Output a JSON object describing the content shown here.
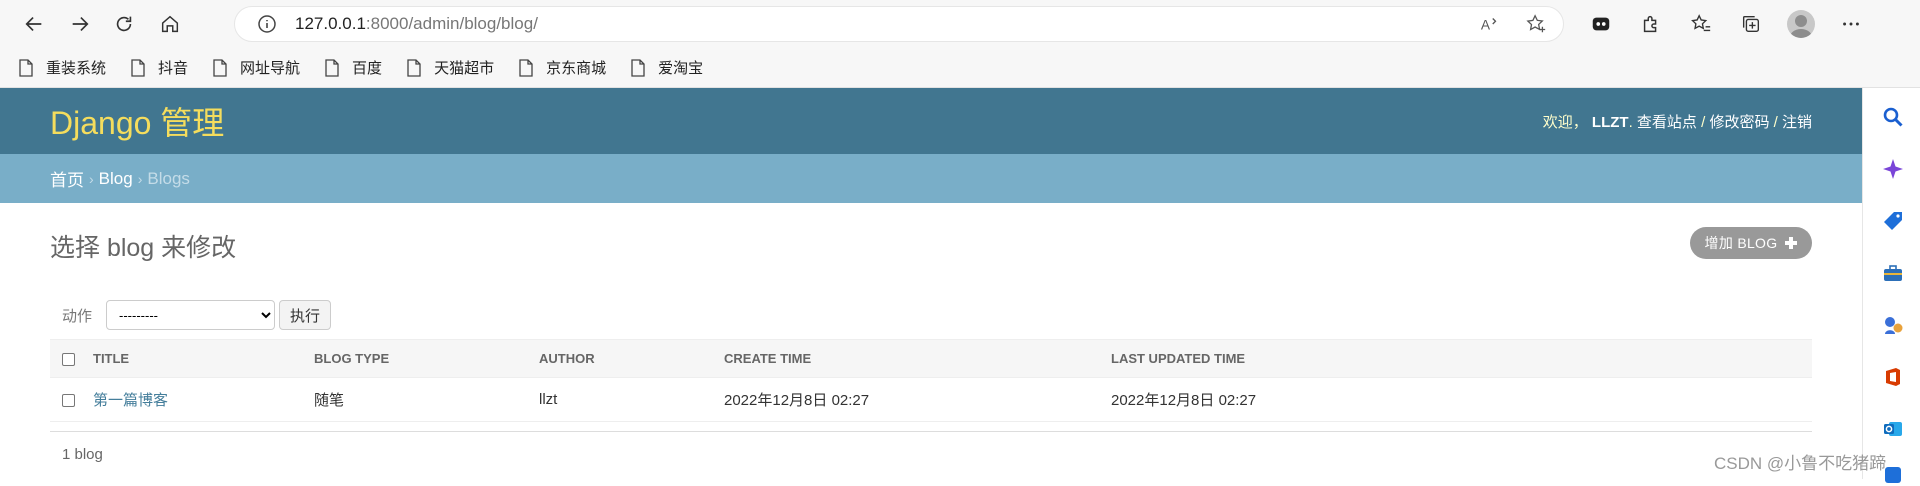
{
  "browser": {
    "url_host": "127.0.0.1",
    "url_rest": ":8000/admin/blog/blog/",
    "bookmarks": [
      "重装系统",
      "抖音",
      "网址导航",
      "百度",
      "天猫超市",
      "京东商城",
      "爱淘宝"
    ]
  },
  "admin": {
    "site_title": "Django 管理",
    "welcome": "欢迎，",
    "username": "LLZT",
    "view_site": "查看站点",
    "change_password": "修改密码",
    "logout": "注销",
    "separator": " / ",
    "breadcrumb": {
      "home": "首页",
      "app": "Blog",
      "current": "Blogs"
    },
    "heading": "选择 blog 来修改",
    "add_button": "增加 BLOG",
    "action_label": "动作",
    "action_select": "---------",
    "go_button": "执行",
    "columns": [
      "TITLE",
      "BLOG TYPE",
      "AUTHOR",
      "CREATE TIME",
      "LAST UPDATED TIME"
    ],
    "rows": [
      {
        "title": "第一篇博客",
        "blog_type": "随笔",
        "author": "llzt",
        "create_time": "2022年12月8日 02:27",
        "last_updated": "2022年12月8日 02:27"
      }
    ],
    "paginator": "1 blog"
  },
  "watermark": "CSDN @小鲁不吃猪蹄"
}
